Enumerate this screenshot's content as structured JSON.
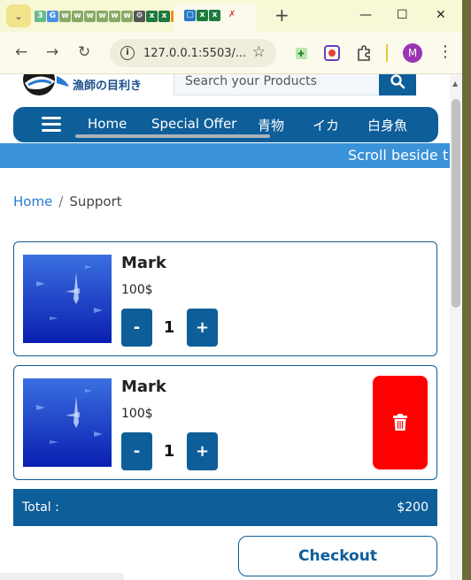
{
  "browser": {
    "url": "127.0.0.1:5503/...",
    "avatar_letter": "M",
    "tab_dropdown": "⌄",
    "new_tab": "+",
    "minimize": "—",
    "maximize": "☐",
    "close": "✕"
  },
  "site": {
    "logo_text": "漁師の目利き",
    "search_placeholder": "Search your Products",
    "nav": [
      "Home",
      "Special Offer",
      "青物",
      "イカ",
      "白身魚"
    ],
    "marquee": "Scroll beside t"
  },
  "breadcrumb": {
    "home": "Home",
    "separator": "/",
    "current": "Support"
  },
  "cart": {
    "items": [
      {
        "name": "Mark",
        "price": "100$",
        "quantity": "1",
        "minus": "-",
        "plus": "+"
      },
      {
        "name": "Mark",
        "price": "100$",
        "quantity": "1",
        "minus": "-",
        "plus": "+"
      }
    ],
    "total_label": "Total :",
    "total_value": "$200",
    "checkout": "Checkout"
  },
  "colors": {
    "primary": "#0d5e99",
    "marquee": "#3a92d9",
    "delete": "#ff0000",
    "link": "#2a7bd2"
  }
}
